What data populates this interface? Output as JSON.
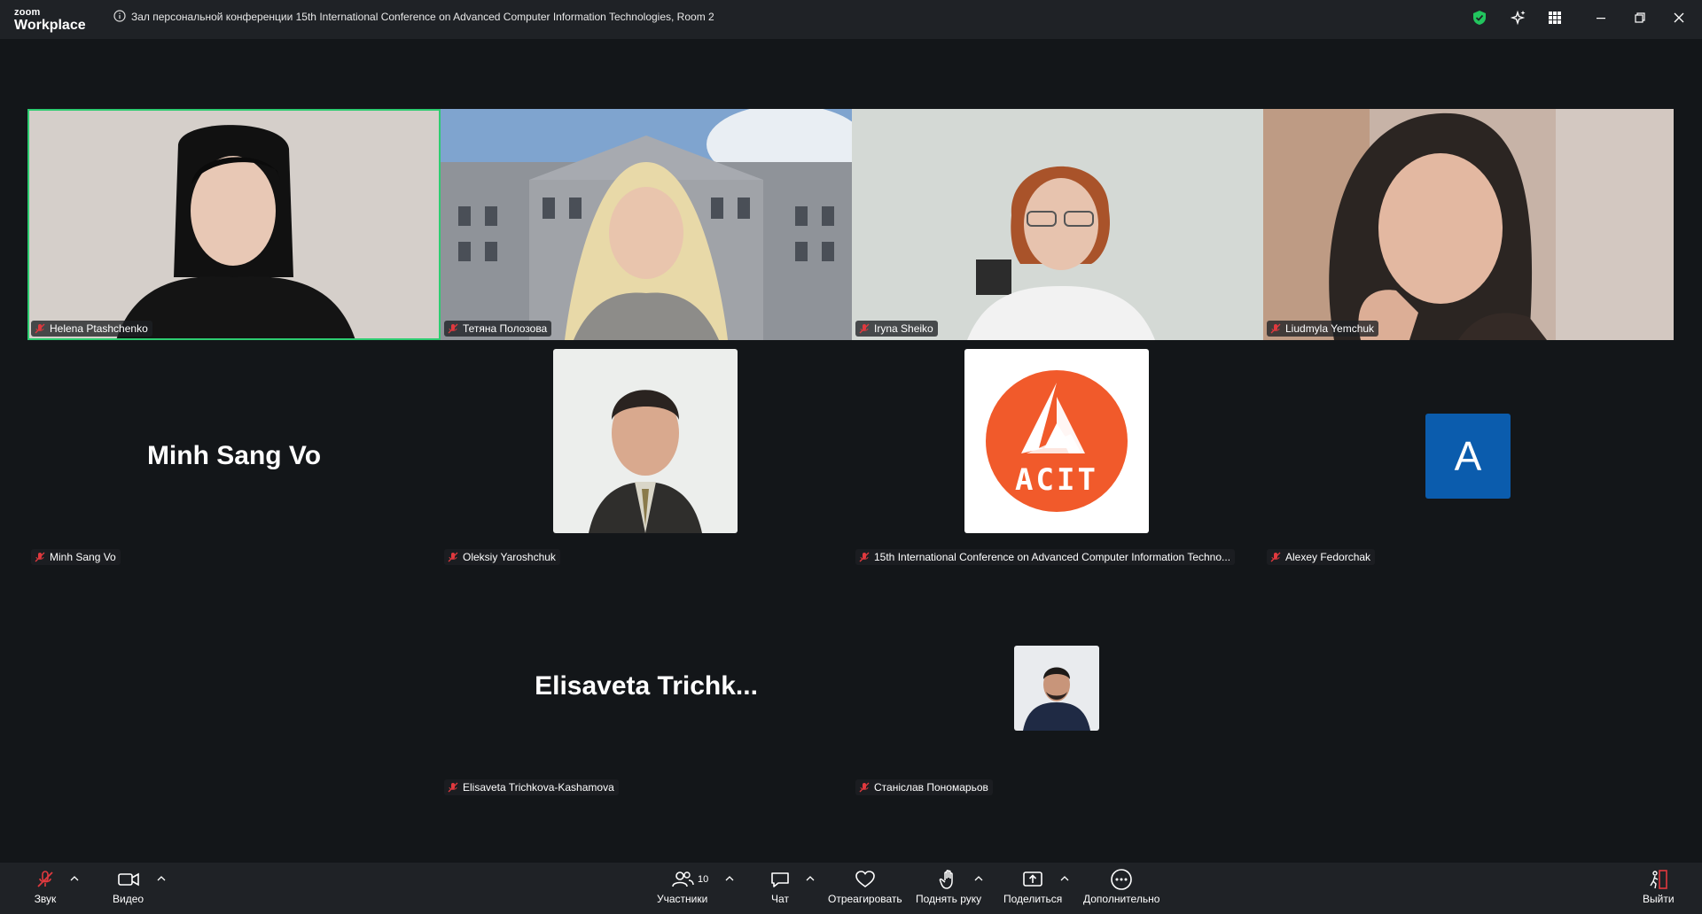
{
  "app": {
    "logo_top": "zoom",
    "logo_bottom": "Workplace",
    "meeting_title": "Зал персональной конференции 15th International Conference on Advanced Computer Information Technologies, Room 2"
  },
  "participants": {
    "helena": "Helena Ptashchenko",
    "tetiana": "Тетяна Полозова",
    "iryna": "Iryna Sheiko",
    "liudmyla": "Liudmyla Yemchuk",
    "minh": "Minh Sang Vo",
    "minh_big": "Minh Sang Vo",
    "oleksiy": "Oleksiy Yaroshchuk",
    "acit": "15th International Conference on Advanced Computer Information Techno...",
    "acit_logo": "ACIT",
    "alexey": "Alexey Fedorchak",
    "alexey_initial": "A",
    "elisaveta": "Elisaveta Trichkova-Kashamova",
    "elisaveta_big": "Elisaveta  Trichk...",
    "stanislav": "Станіслав Пономарьов"
  },
  "toolbar": {
    "audio": "Звук",
    "video": "Видео",
    "participants": "Участники",
    "participants_count": "10",
    "chat": "Чат",
    "react": "Отреагировать",
    "raise_hand": "Поднять руку",
    "share": "Поделиться",
    "more": "Дополнительно",
    "leave": "Выйти"
  },
  "colors": {
    "active_speaker_border": "#2ecc71",
    "muted_icon": "#e0393e",
    "acit_orange": "#f15a2b",
    "avatar_blue": "#0b5cad",
    "shield_green": "#22c55e"
  }
}
